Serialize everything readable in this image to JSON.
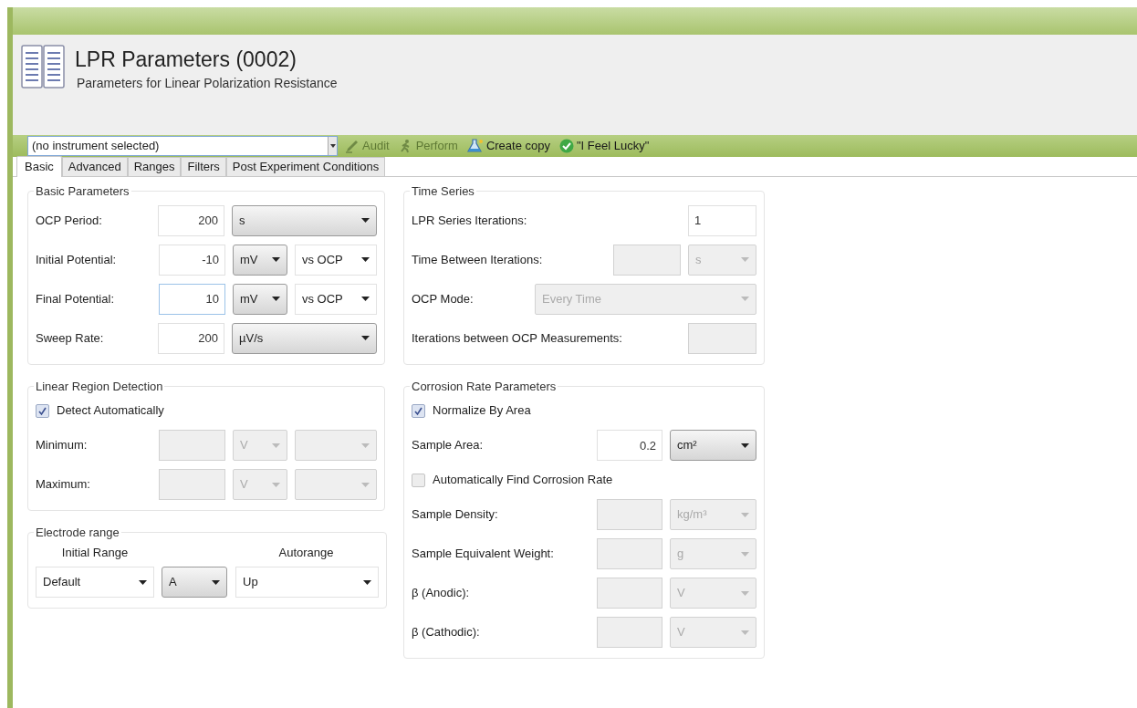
{
  "title": "LPR Parameters (0002)",
  "subtitle": "Parameters for Linear Polarization Resistance",
  "toolbar": {
    "instrument": {
      "value": "(no instrument selected)"
    },
    "buttons": [
      {
        "label": "Audit",
        "kind": "audit",
        "disabled": true
      },
      {
        "label": "Perform",
        "kind": "perform",
        "disabled": true
      },
      {
        "label": "Create copy",
        "kind": "copy",
        "disabled": false
      },
      {
        "label": "\"I Feel Lucky\"",
        "kind": "lucky",
        "disabled": false
      }
    ]
  },
  "tabs": [
    {
      "label": "Basic",
      "selected": true
    },
    {
      "label": "Advanced",
      "selected": false
    },
    {
      "label": "Ranges",
      "selected": false
    },
    {
      "label": "Filters",
      "selected": false
    },
    {
      "label": "Post Experiment Conditions",
      "selected": false
    }
  ],
  "left_groups": [
    {
      "title": "Basic Parameters",
      "rows": [
        {
          "kind": "field",
          "label": "OCP Period:",
          "controls": [
            {
              "kind": "input",
              "value": "200",
              "disabled": false,
              "focused": false
            },
            {
              "kind": "select",
              "value": "s",
              "disabled": false
            }
          ]
        },
        {
          "kind": "field",
          "label": "Initial Potential:",
          "controls": [
            {
              "kind": "input",
              "value": "-10",
              "disabled": false,
              "focused": false
            },
            {
              "kind": "select",
              "value": "mV",
              "disabled": false
            },
            {
              "kind": "combo",
              "value": "vs OCP",
              "disabled": false
            }
          ]
        },
        {
          "kind": "field",
          "label": "Final Potential:",
          "controls": [
            {
              "kind": "input",
              "value": "10",
              "disabled": false,
              "focused": true
            },
            {
              "kind": "select",
              "value": "mV",
              "disabled": false
            },
            {
              "kind": "combo",
              "value": "vs OCP",
              "disabled": false
            }
          ]
        },
        {
          "kind": "field",
          "label": "Sweep Rate:",
          "controls": [
            {
              "kind": "input",
              "value": "200",
              "disabled": false,
              "focused": false
            },
            {
              "kind": "select",
              "value": "µV/s",
              "disabled": false
            }
          ]
        }
      ]
    },
    {
      "title": "Linear Region Detection",
      "rows": [
        {
          "kind": "checkbox",
          "label": "Detect Automatically",
          "checked": true
        },
        {
          "kind": "field",
          "label": "Minimum:",
          "controls": [
            {
              "kind": "input",
              "disabled": true,
              "focused": false
            },
            {
              "kind": "select",
              "value": "V",
              "disabled": true
            },
            {
              "kind": "select",
              "disabled": true
            }
          ]
        },
        {
          "kind": "field",
          "label": "Maximum:",
          "controls": [
            {
              "kind": "input",
              "disabled": true,
              "focused": false
            },
            {
              "kind": "select",
              "value": "V",
              "disabled": true
            },
            {
              "kind": "select",
              "disabled": true
            }
          ]
        }
      ]
    },
    {
      "title": "Electrode range",
      "headers": [
        "Initial Range",
        "Autorange"
      ],
      "rows": [
        {
          "kind": "plain",
          "controls": [
            {
              "kind": "combo",
              "value": "Default",
              "disabled": false
            },
            {
              "kind": "select",
              "value": "A",
              "disabled": false
            },
            {
              "kind": "combo",
              "value": "Up",
              "disabled": false
            }
          ]
        }
      ]
    }
  ],
  "right_groups": [
    {
      "title": "Time Series",
      "rows": [
        {
          "kind": "field",
          "label": "LPR Series Iterations:",
          "controls": [
            {
              "kind": "counter",
              "value": "1",
              "disabled": false,
              "focused": false
            }
          ]
        },
        {
          "kind": "field",
          "label": "Time Between Iterations:",
          "controls": [
            {
              "kind": "input",
              "disabled": true,
              "focused": false
            },
            {
              "kind": "select",
              "value": "s",
              "disabled": true
            }
          ]
        },
        {
          "kind": "field",
          "label": "OCP Mode:",
          "controls": [
            {
              "kind": "select",
              "value": "Every Time",
              "disabled": true
            }
          ]
        },
        {
          "kind": "field",
          "label": "Iterations between OCP Measurements:",
          "controls": [
            {
              "kind": "input",
              "disabled": true,
              "focused": false
            }
          ]
        }
      ]
    },
    {
      "title": "Corrosion Rate Parameters",
      "rows": [
        {
          "kind": "checkbox",
          "label": "Normalize By Area",
          "checked": true
        },
        {
          "kind": "field",
          "label": "Sample Area:",
          "controls": [
            {
              "kind": "input",
              "value": "0.2",
              "disabled": false,
              "focused": false
            },
            {
              "kind": "select",
              "value": "cm²",
              "disabled": false
            }
          ]
        },
        {
          "kind": "checkbox",
          "label": "Automatically Find Corrosion Rate",
          "checked": false
        },
        {
          "kind": "field",
          "label": "Sample Density:",
          "controls": [
            {
              "kind": "input",
              "disabled": true,
              "focused": false
            },
            {
              "kind": "select",
              "value": "kg/m³",
              "disabled": true
            }
          ]
        },
        {
          "kind": "field",
          "label": "Sample Equivalent Weight:",
          "controls": [
            {
              "kind": "input",
              "disabled": true,
              "focused": false
            },
            {
              "kind": "select",
              "value": "g",
              "disabled": true
            }
          ]
        },
        {
          "kind": "field",
          "label": "β (Anodic):",
          "controls": [
            {
              "kind": "input",
              "disabled": true,
              "focused": false
            },
            {
              "kind": "select",
              "value": "V",
              "disabled": true
            }
          ]
        },
        {
          "kind": "field",
          "label": "β (Cathodic):",
          "controls": [
            {
              "kind": "input",
              "disabled": true,
              "focused": false
            },
            {
              "kind": "select",
              "value": "V",
              "disabled": true
            }
          ]
        }
      ]
    }
  ]
}
